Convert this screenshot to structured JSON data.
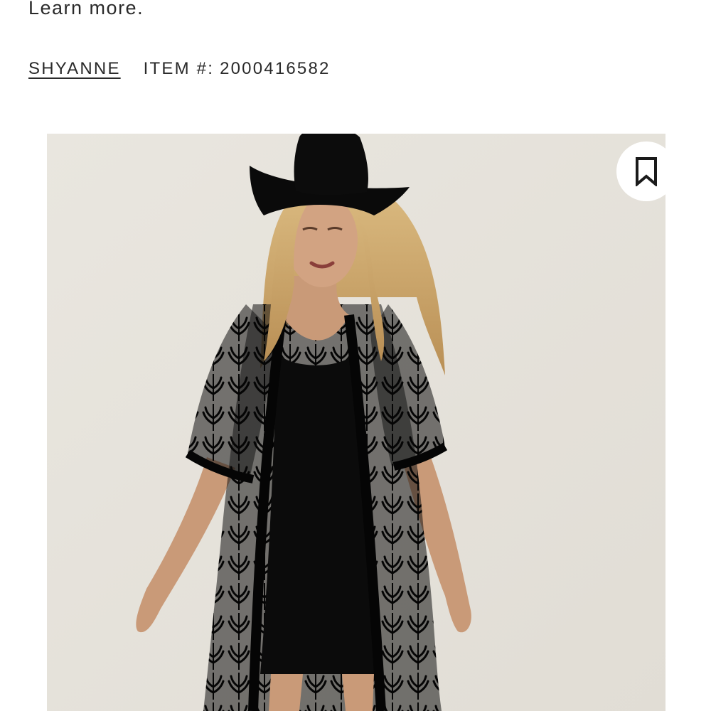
{
  "header": {
    "learn_more": "Learn more."
  },
  "product": {
    "brand": "SHYANNE",
    "item_number_label": "ITEM #:",
    "item_number": "2000416582"
  },
  "image": {
    "alt": "Model wearing a black lace duster kimono over a black slip dress with a black cowboy hat",
    "background_color": "#e7e3dc"
  },
  "actions": {
    "bookmark_icon": "bookmark-icon"
  }
}
